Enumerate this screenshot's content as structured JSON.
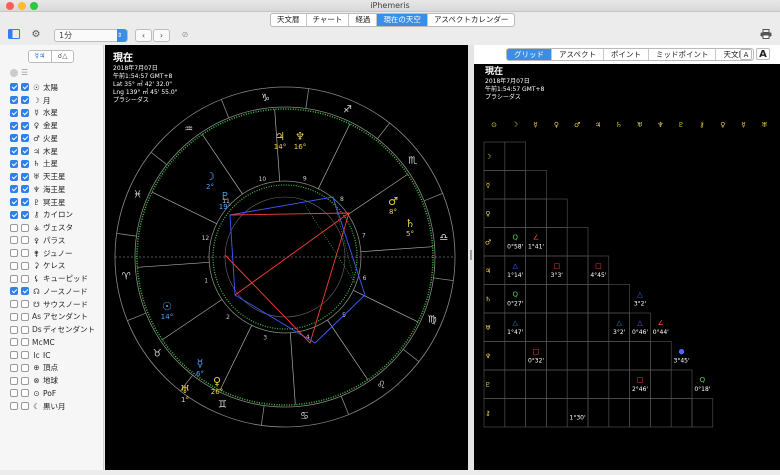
{
  "window": {
    "title": "iPhemeris"
  },
  "top_tabs": [
    {
      "label": "天文暦",
      "active": false
    },
    {
      "label": "チャート",
      "active": false
    },
    {
      "label": "経過",
      "active": false
    },
    {
      "label": "現在の天空",
      "active": true
    },
    {
      "label": "アスペクトカレンダー",
      "active": false
    }
  ],
  "toolbar": {
    "interval_value": "1分"
  },
  "sidebar": {
    "tab_planets": "☿♃",
    "tab_aspects": "☌△",
    "bodies": [
      {
        "glyph": "☉",
        "label": "太陽",
        "checked": true,
        "checked2": true
      },
      {
        "glyph": "☽",
        "label": "月",
        "checked": true,
        "checked2": true
      },
      {
        "glyph": "☿",
        "label": "水星",
        "checked": true,
        "checked2": true
      },
      {
        "glyph": "♀",
        "label": "金星",
        "checked": true,
        "checked2": true
      },
      {
        "glyph": "♂",
        "label": "火星",
        "checked": true,
        "checked2": true
      },
      {
        "glyph": "♃",
        "label": "木星",
        "checked": true,
        "checked2": true
      },
      {
        "glyph": "♄",
        "label": "土星",
        "checked": true,
        "checked2": true
      },
      {
        "glyph": "♅",
        "label": "天王星",
        "checked": true,
        "checked2": true
      },
      {
        "glyph": "♆",
        "label": "海王星",
        "checked": true,
        "checked2": true
      },
      {
        "glyph": "♇",
        "label": "冥王星",
        "checked": true,
        "checked2": true
      },
      {
        "glyph": "⚷",
        "label": "カイロン",
        "checked": true,
        "checked2": true
      },
      {
        "glyph": "⚶",
        "label": "ヴェスタ",
        "checked": false,
        "checked2": false
      },
      {
        "glyph": "⚴",
        "label": "パラス",
        "checked": false,
        "checked2": false
      },
      {
        "glyph": "⚵",
        "label": "ジュノー",
        "checked": false,
        "checked2": false
      },
      {
        "glyph": "⚳",
        "label": "ケレス",
        "checked": false,
        "checked2": false
      },
      {
        "glyph": "⚸",
        "label": "キューピッド",
        "checked": false,
        "checked2": false
      },
      {
        "glyph": "☊",
        "label": "ノースノード",
        "checked": true,
        "checked2": true
      },
      {
        "glyph": "☋",
        "label": "サウスノード",
        "checked": false,
        "checked2": false
      },
      {
        "glyph": "As",
        "label": "アセンダント",
        "checked": false,
        "checked2": false
      },
      {
        "glyph": "Ds",
        "label": "ディセンダント",
        "checked": false,
        "checked2": false
      },
      {
        "glyph": "Mc",
        "label": "MC",
        "checked": false,
        "checked2": false
      },
      {
        "glyph": "Ic",
        "label": "IC",
        "checked": false,
        "checked2": false
      },
      {
        "glyph": "⊕",
        "label": "頂点",
        "checked": false,
        "checked2": false
      },
      {
        "glyph": "⊗",
        "label": "地球",
        "checked": false,
        "checked2": false
      },
      {
        "glyph": "⊙",
        "label": "PoF",
        "checked": false,
        "checked2": false
      },
      {
        "glyph": "☾",
        "label": "黒い月",
        "checked": false,
        "checked2": false
      }
    ]
  },
  "chart": {
    "title": "現在",
    "date": "2018年7月07日",
    "time": "午前1:54:57 GMT+8",
    "lat": "Lat 35° ㎡ 42' 32.0\"",
    "lng": "Lng 139° ㎡ 45' 55.0\"",
    "house_system": "プラシーダス",
    "sign_glyphs": [
      "♈",
      "♉",
      "♊",
      "♋",
      "♌",
      "♍",
      "♎",
      "♏",
      "♐",
      "♑",
      "♒",
      "♓"
    ],
    "house_numbers": [
      "1",
      "2",
      "3",
      "4",
      "5",
      "6",
      "7",
      "8",
      "9",
      "10",
      "11",
      "12"
    ],
    "planet_labels": [
      {
        "glyph": "♇",
        "deg": "19°",
        "color": "#4aa3ff"
      },
      {
        "glyph": "☽",
        "deg": "2°",
        "color": "#4aa3ff"
      },
      {
        "glyph": "♃",
        "deg": "14°",
        "color": "#e8d24a"
      },
      {
        "glyph": "♆",
        "deg": "16°",
        "color": "#e8d24a"
      },
      {
        "glyph": "☉",
        "deg": "14°",
        "color": "#4aa3ff"
      },
      {
        "glyph": "♀",
        "deg": "26°",
        "color": "#e8d24a"
      },
      {
        "glyph": "♂",
        "deg": "8°",
        "color": "#e8d24a"
      },
      {
        "glyph": "♄",
        "deg": "5°",
        "color": "#e8d24a"
      },
      {
        "glyph": "☿",
        "deg": "6°",
        "color": "#4aa3ff"
      },
      {
        "glyph": "♅",
        "deg": "1°",
        "color": "#e8d24a"
      }
    ]
  },
  "right_panel": {
    "tabs": [
      {
        "label": "グリッド",
        "active": true
      },
      {
        "label": "アスペクト",
        "active": false
      },
      {
        "label": "ポイント",
        "active": false
      },
      {
        "label": "ミッドポイント",
        "active": false
      },
      {
        "label": "天文暦",
        "active": false
      }
    ],
    "font_small": "A",
    "font_large": "A",
    "grid_title": "現在",
    "grid_date": "2018年7月07日",
    "grid_time": "午前1:54:57 GMT+8",
    "grid_house": "プラシーダス",
    "header_glyphs": [
      "⊙",
      "☽",
      "☿",
      "♀",
      "♂",
      "♃",
      "♄",
      "♅",
      "♆",
      "♇",
      "⚷",
      "♀",
      "☿",
      "♅"
    ],
    "row_glyphs": [
      "☽",
      "☿",
      "♀",
      "♂",
      "♃",
      "♄",
      "♅",
      "♆",
      "♇",
      "⚷"
    ],
    "aspect_cells": [
      {
        "row": 3,
        "col": 0,
        "sym": "Q",
        "orb": "0°58'",
        "color": "#4cd04c"
      },
      {
        "row": 3,
        "col": 1,
        "sym": "∠",
        "orb": "1°41'",
        "color": "#ff4a4a"
      },
      {
        "row": 4,
        "col": 0,
        "sym": "△",
        "orb": "1°14'",
        "color": "#4a6aff"
      },
      {
        "row": 4,
        "col": 2,
        "sym": "□",
        "orb": "3°3'",
        "color": "#ff4a4a"
      },
      {
        "row": 4,
        "col": 4,
        "sym": "□",
        "orb": "4°45'",
        "color": "#ff4a4a"
      },
      {
        "row": 5,
        "col": 0,
        "sym": "Q",
        "orb": "0°27'",
        "color": "#4cd04c"
      },
      {
        "row": 5,
        "col": 6,
        "sym": "△",
        "orb": "3°2'",
        "color": "#4a6aff"
      },
      {
        "row": 6,
        "col": 0,
        "sym": "△",
        "orb": "1°47'",
        "color": "#4a6aff"
      },
      {
        "row": 6,
        "col": 5,
        "sym": "△",
        "orb": "3°2'",
        "color": "#4a6aff"
      },
      {
        "row": 6,
        "col": 6,
        "sym": "△",
        "orb": "0°46'",
        "color": "#4a6aff"
      },
      {
        "row": 6,
        "col": 7,
        "sym": "∠",
        "orb": "0°44'",
        "color": "#ff4a4a"
      },
      {
        "row": 7,
        "col": 1,
        "sym": "□",
        "orb": "0°32'",
        "color": "#ff4a4a"
      },
      {
        "row": 7,
        "col": 8,
        "sym": "●",
        "orb": "3°45'",
        "color": "#4a6aff"
      },
      {
        "row": 8,
        "col": 6,
        "sym": "□",
        "orb": "2°46'",
        "color": "#ff4a4a"
      },
      {
        "row": 8,
        "col": 9,
        "sym": "Q",
        "orb": "0°18'",
        "color": "#4cd04c"
      },
      {
        "row": 9,
        "col": 3,
        "sym": "",
        "orb": "1°30'",
        "color": "#ffffff"
      }
    ]
  }
}
